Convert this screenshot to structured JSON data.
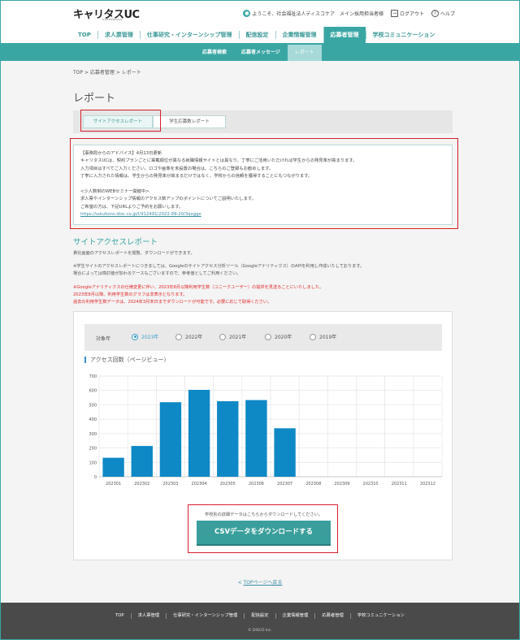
{
  "header": {
    "logo": "キャリタスUC",
    "logo_sub": "CAREERTASU",
    "welcome": "ようこそ、社会福祉法人ディスコケア　メイン採用担当者様",
    "logout": "ログアウト",
    "help": "ヘルプ"
  },
  "main_nav": [
    "TOP",
    "求人票管理",
    "仕事研究・インターンシップ管理",
    "配信設定",
    "企業情報管理",
    "応募者管理",
    "学校コミュニケーション"
  ],
  "main_nav_active": "応募者管理",
  "sub_nav": [
    "応募者検索",
    "応募者メッセージ",
    "レポート"
  ],
  "sub_nav_active": "レポート",
  "breadcrumb": "TOP > 応募者管理 > レポート",
  "page_title": "レポート",
  "tabs": {
    "site_access": "サイトアクセスレポート",
    "applicants": "学生応募数レポート"
  },
  "advice": {
    "line1": "【事務局からのアドバイス】4月13日更新",
    "line2": "キャリタスUCは、契約プランごとに掲載順位が異なる就職情報サイトとは異なり、丁寧にご活用いただければ学生からの発見率が高まります。",
    "line3": "入力項目はすべてご入力ください。ロゴや画像を未設置の場合は、こちらのご登録もお勧めします。",
    "line4": "丁寧に入力された情報は、学生からの発見率が高まるだけではなく、学校からの信頼を獲得することにもつながります。",
    "line5": "<少人数制のWEBセミナー開催中>",
    "line6": "求人票やインターンシップ情報のアクセス数アップのポイントについてご説明いたします。",
    "line7": "ご希望の方は、下記URLよりご予約をお願いします。",
    "url": "https://solutions.disc.co.jp/l/912491/2022-09-20/3qxgge"
  },
  "section": {
    "title": "サイトアクセスレポート",
    "desc1": "貴社画面のアクセスレポートを閲覧、ダウンロードができます。",
    "desc2": "※学生サイトのアクセスレポートにつきましては、Googleのサイトアクセス分析ツール（Googleアナリティクス）のAPIを利用し作成いたしております。",
    "desc3": "場合によっては検討値が加わるケースもございますので、参考値としてご利用ください。",
    "red1": "※Googleアナリティクスの仕様変更に伴い、2023年8月以降利用学生数（ユニークユーザー）の提供を見送ることにいたしました。",
    "red2": "2023年8月以降、利用学生数のグラフは非表示となります。",
    "red3": "過去の利用学生数データは、2024年3月末日までダウンロードが可能です。必要に応じて取得ください。"
  },
  "year_filter": {
    "label": "対象年",
    "options": [
      "2023年",
      "2022年",
      "2021年",
      "2020年",
      "2019年"
    ],
    "selected": "2023年"
  },
  "chart_data": {
    "type": "bar",
    "title": "アクセス回数（ページビュー）",
    "categories": [
      "202301",
      "202302",
      "202303",
      "202304",
      "202305",
      "202306",
      "202307",
      "202308",
      "202309",
      "202310",
      "202311",
      "202312"
    ],
    "values": [
      132,
      214,
      518,
      604,
      525,
      533,
      337,
      0,
      0,
      0,
      0,
      0
    ],
    "ylim": [
      0,
      700
    ],
    "yticks": [
      0,
      100,
      200,
      300,
      400,
      500,
      600,
      700
    ],
    "grid": true,
    "color": "#0f88c6"
  },
  "download": {
    "note": "学校別の詳細データはこちらからダウンロードしてください。",
    "button": "CSVデータをダウンロードする"
  },
  "top_link": "TOPページへ戻る",
  "footer": {
    "nav": [
      "TOP",
      "求人票管理",
      "仕事研究・インターンシップ管理",
      "配信設定",
      "企業情報管理",
      "応募者管理",
      "学校コミュニケーション"
    ],
    "copyright": "© DISCO Inc."
  }
}
